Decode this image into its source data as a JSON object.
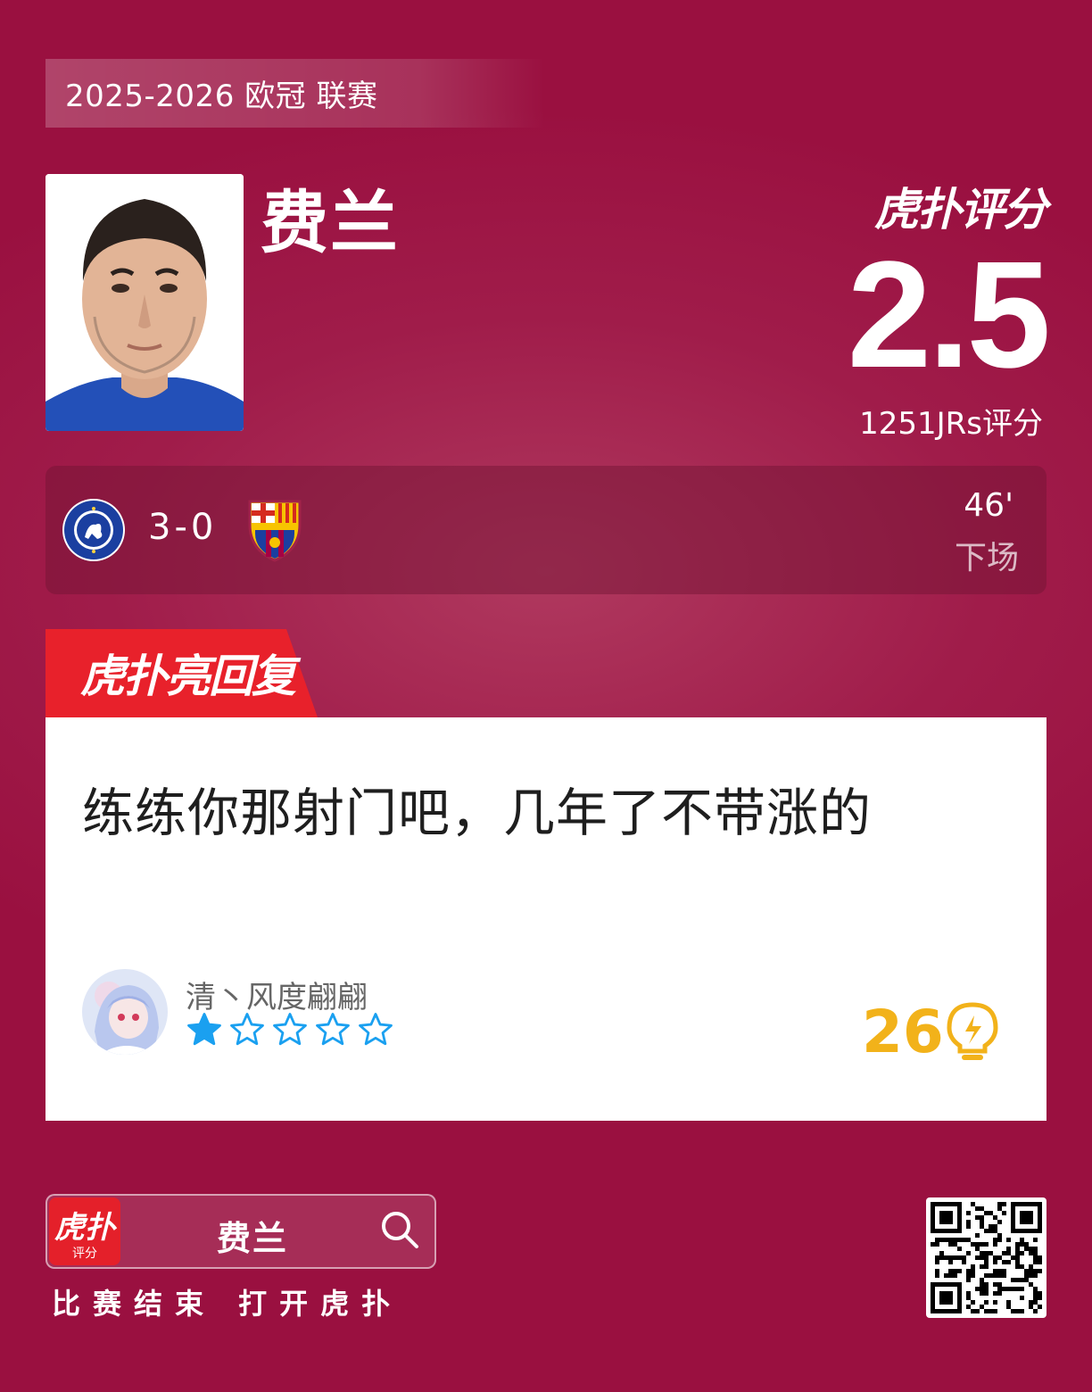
{
  "season_label": "2025-2026 欧冠 联赛",
  "player": {
    "name": "费兰"
  },
  "brand": {
    "rating_logo": "虎扑评分",
    "reply_logo": "虎扑亮回复",
    "app_icon_main": "虎扑",
    "app_icon_sub": "评分"
  },
  "rating": {
    "score": "2.5",
    "count_label": "1251JRs评分"
  },
  "match": {
    "home_team_icon": "chelsea-crest-icon",
    "away_team_icon": "barcelona-crest-icon",
    "score": "3-0",
    "minute": "46'",
    "status": "下场"
  },
  "reply": {
    "text": "练练你那射门吧，几年了不带涨的",
    "username": "清丶风度翩翩",
    "stars": 1,
    "stars_max": 5,
    "likes": "26",
    "like_icon": "lightbulb-icon"
  },
  "search": {
    "query": "费兰",
    "icon": "search-icon"
  },
  "footer_text": "比赛结束 打开虎扑",
  "colors": {
    "background": "#a01c4a",
    "accent_red": "#e8212b",
    "like_yellow": "#f2b21a",
    "star_blue": "#1aa0f0"
  }
}
